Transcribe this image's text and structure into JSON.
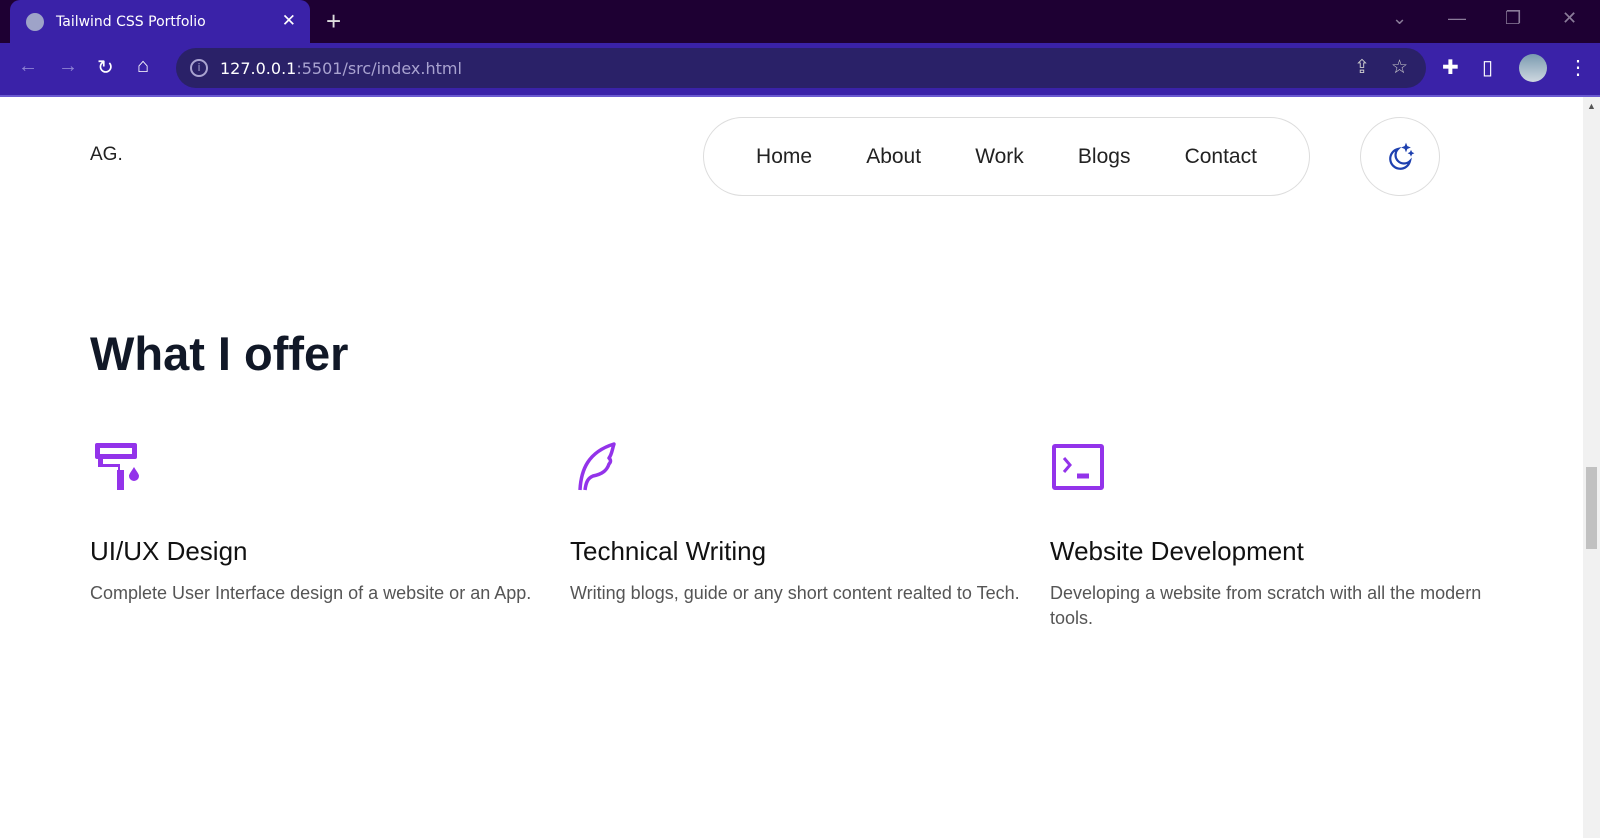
{
  "browser": {
    "tab_title": "Tailwind CSS Portfolio",
    "url_host": "127.0.0.1",
    "url_rest": ":5501/src/index.html"
  },
  "header": {
    "logo": "AG.",
    "nav": [
      "Home",
      "About",
      "Work",
      "Blogs",
      "Contact"
    ]
  },
  "section": {
    "title": "What I offer",
    "services": [
      {
        "icon": "paint-roller-icon",
        "title": "UI/UX Design",
        "desc": "Complete User Interface design of a website or an App."
      },
      {
        "icon": "feather-icon",
        "title": "Technical Writing",
        "desc": "Writing blogs, guide or any short content realted to Tech."
      },
      {
        "icon": "terminal-icon",
        "title": "Website Development",
        "desc": "Developing a website from scratch with all the modern tools."
      }
    ]
  },
  "colors": {
    "accent": "#9333ea",
    "moon": "#1e40af",
    "chrome": "#3a22a8"
  }
}
